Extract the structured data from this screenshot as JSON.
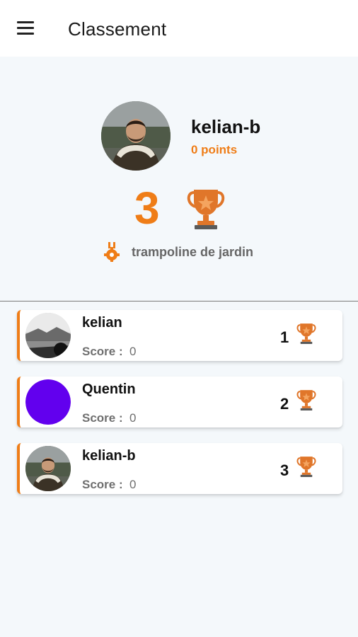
{
  "appbar": {
    "menu_icon": "menu-icon",
    "title": "Classement"
  },
  "profile": {
    "username": "kelian-b",
    "points": "0 points",
    "rank": "3",
    "trophy_icon": "trophy-icon",
    "product_icon": "medal-gear-icon",
    "product": "trampoline de jardin",
    "avatar": "photo"
  },
  "colors": {
    "accent": "#ef7d17",
    "trophy": "#e0762a",
    "purple_avatar": "#6200ee",
    "background": "#f4f8fb"
  },
  "leaderboard": [
    {
      "name": "kelian",
      "score_label": "Score :",
      "score": "0",
      "rank": "1",
      "avatar": "landscape-photo"
    },
    {
      "name": "Quentin",
      "score_label": "Score :",
      "score": "0",
      "rank": "2",
      "avatar": "purple-circle"
    },
    {
      "name": "kelian-b",
      "score_label": "Score :",
      "score": "0",
      "rank": "3",
      "avatar": "photo"
    }
  ]
}
